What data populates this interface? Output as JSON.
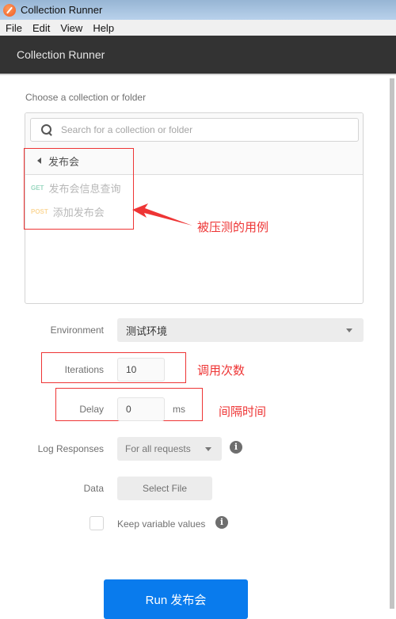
{
  "window": {
    "title": "Collection Runner",
    "icon": "postman-app-icon"
  },
  "menubar": {
    "items": [
      "File",
      "Edit",
      "View",
      "Help"
    ]
  },
  "header": {
    "title": "Collection Runner"
  },
  "chooser": {
    "label": "Choose a collection or folder",
    "search_placeholder": "Search for a collection or folder",
    "search_value": "",
    "folder": {
      "name": "发布会",
      "icon": "caret-left-icon"
    },
    "requests": [
      {
        "method": "GET",
        "name": "发布会信息查询",
        "method_color": "#9bd8c1"
      },
      {
        "method": "POST",
        "name": "添加发布会",
        "method_color": "#fbd89a"
      }
    ]
  },
  "form": {
    "environment": {
      "label": "Environment",
      "value": "测试环境"
    },
    "iterations": {
      "label": "Iterations",
      "value": "10"
    },
    "delay": {
      "label": "Delay",
      "value": "0",
      "unit": "ms"
    },
    "log_responses": {
      "label": "Log Responses",
      "value": "For all requests"
    },
    "data": {
      "label": "Data",
      "button": "Select File"
    },
    "keep_variables": {
      "label": "Keep variable values",
      "checked": false
    }
  },
  "run_button": {
    "label": "Run 发布会",
    "color": "#097bed"
  },
  "annotations": {
    "color": "#ee3535",
    "requests_note": "被压测的用例",
    "iterations_note": "调用次数",
    "delay_note": "间隔时间"
  }
}
